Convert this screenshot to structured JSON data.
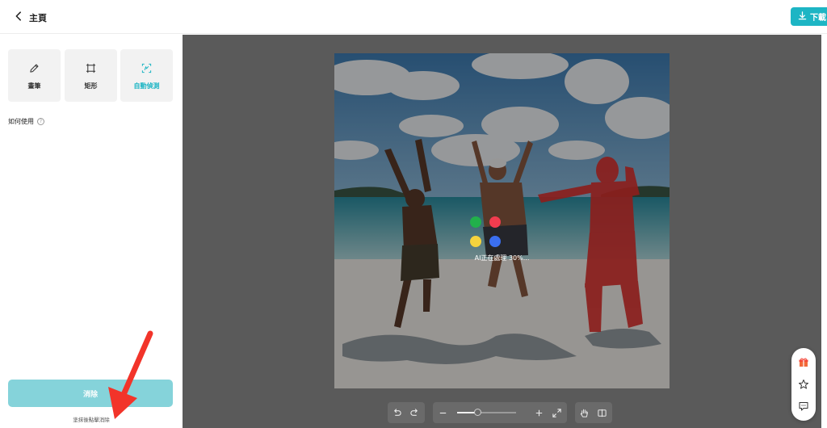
{
  "header": {
    "back_label": "主頁",
    "download_label": "下載"
  },
  "tools": [
    {
      "label": "畫筆",
      "icon": "pencil-icon",
      "active": false
    },
    {
      "label": "矩形",
      "icon": "rectangle-icon",
      "active": false
    },
    {
      "label": "自動偵測",
      "icon": "auto-detect-icon",
      "active": true
    }
  ],
  "help": {
    "label": "如何使用",
    "icon": "question-circle-icon"
  },
  "erase": {
    "label": "消除",
    "hint": "塗抹後點擊消除"
  },
  "processing": {
    "text": "AI正在處理 30%...",
    "progress": 0.3,
    "dot_colors": [
      "#22b04b",
      "#f03c4f",
      "#f5d33d",
      "#3b6ff0"
    ]
  },
  "zoom": {
    "level": 0.35
  },
  "toolbar_icons": [
    "undo-icon",
    "redo-icon",
    "zoom-out-icon",
    "zoom-in-icon",
    "fit-screen-icon",
    "hand-icon",
    "compare-icon"
  ],
  "float_icons": [
    "gift-icon",
    "star-icon",
    "chat-icon"
  ],
  "colors": {
    "accent": "#1db5c4",
    "erase_button": "#85d3da",
    "highlight": "#e0322f"
  }
}
